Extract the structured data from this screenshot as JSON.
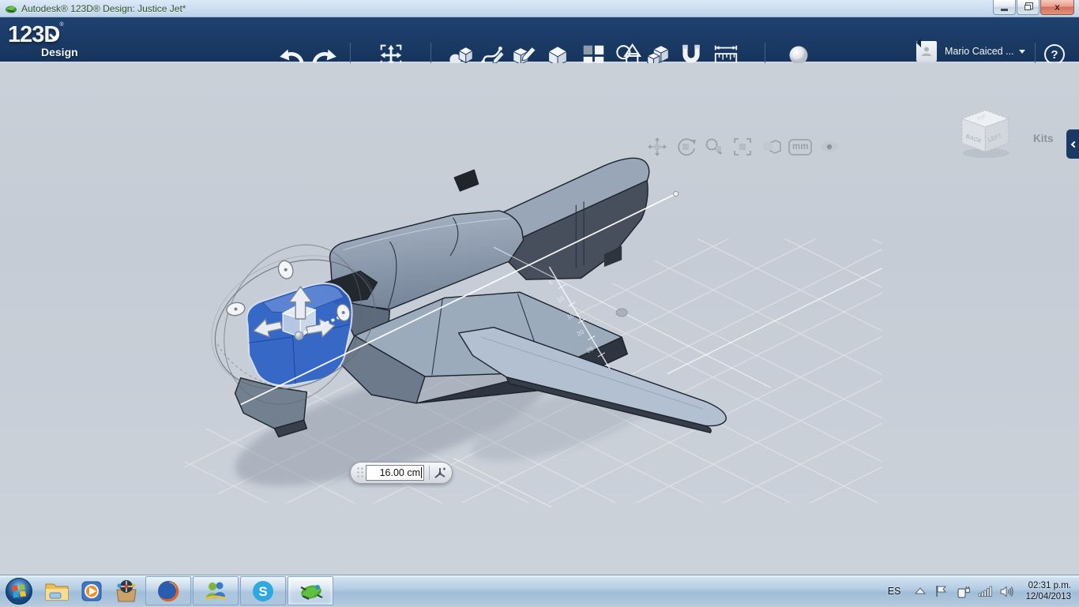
{
  "titlebar": {
    "title": "Autodesk® 123D® Design: Justice Jet*"
  },
  "appbar": {
    "logo": "123D",
    "logo_reg": "®",
    "logo_sub": "Design",
    "user_name": "Mario Caiced ...",
    "help_glyph": "?"
  },
  "viewport": {
    "kits": "Kits",
    "units": "mm",
    "dimension": {
      "value": "16.00 cm"
    },
    "view_cube": {
      "top": "TOP",
      "back": "BACK",
      "left": "LEFT"
    },
    "ruler": {
      "numbers": [
        "5",
        "10",
        "15",
        "20",
        "25"
      ]
    }
  },
  "taskbar": {
    "skype_glyph": "S",
    "tray": {
      "language": "ES",
      "time": "02:31 p.m.",
      "date": "12/04/2013"
    }
  },
  "icons": {
    "app-icon": "green-jet-logo",
    "undo-icon": "curved-arrow-left",
    "redo-icon": "curved-arrow-right",
    "transform-icon": "move-arrows-in-brackets",
    "primitives-icon": "sphere-and-cube",
    "sketch-icon": "spline-with-pencil",
    "construct-icon": "cube-with-pencil",
    "modify-icon": "cube",
    "pattern-icon": "four-squares",
    "group-icon": "overlapping-shapes",
    "combine-icon": "merged-cubes",
    "snap-icon": "magnet",
    "measure-icon": "ruler-with-arrow",
    "render-icon": "sphere",
    "pan-icon": "four-way-arrows",
    "orbit-icon": "circular-arrow-cube",
    "zoom-icon": "magnifier-cube",
    "fit-icon": "cube-in-brackets",
    "shade-icon": "sphere-over-cube",
    "visibility-icon": "eye",
    "triad-icon": "axis-tripod"
  },
  "colors": {
    "toolbar_navy": "#1a3a64",
    "selection_blue": "#2e62c6",
    "viewport_bg": "#c7cdd6",
    "taskbar_blue": "#b3cbe2",
    "close_button_red": "#d4705c"
  }
}
